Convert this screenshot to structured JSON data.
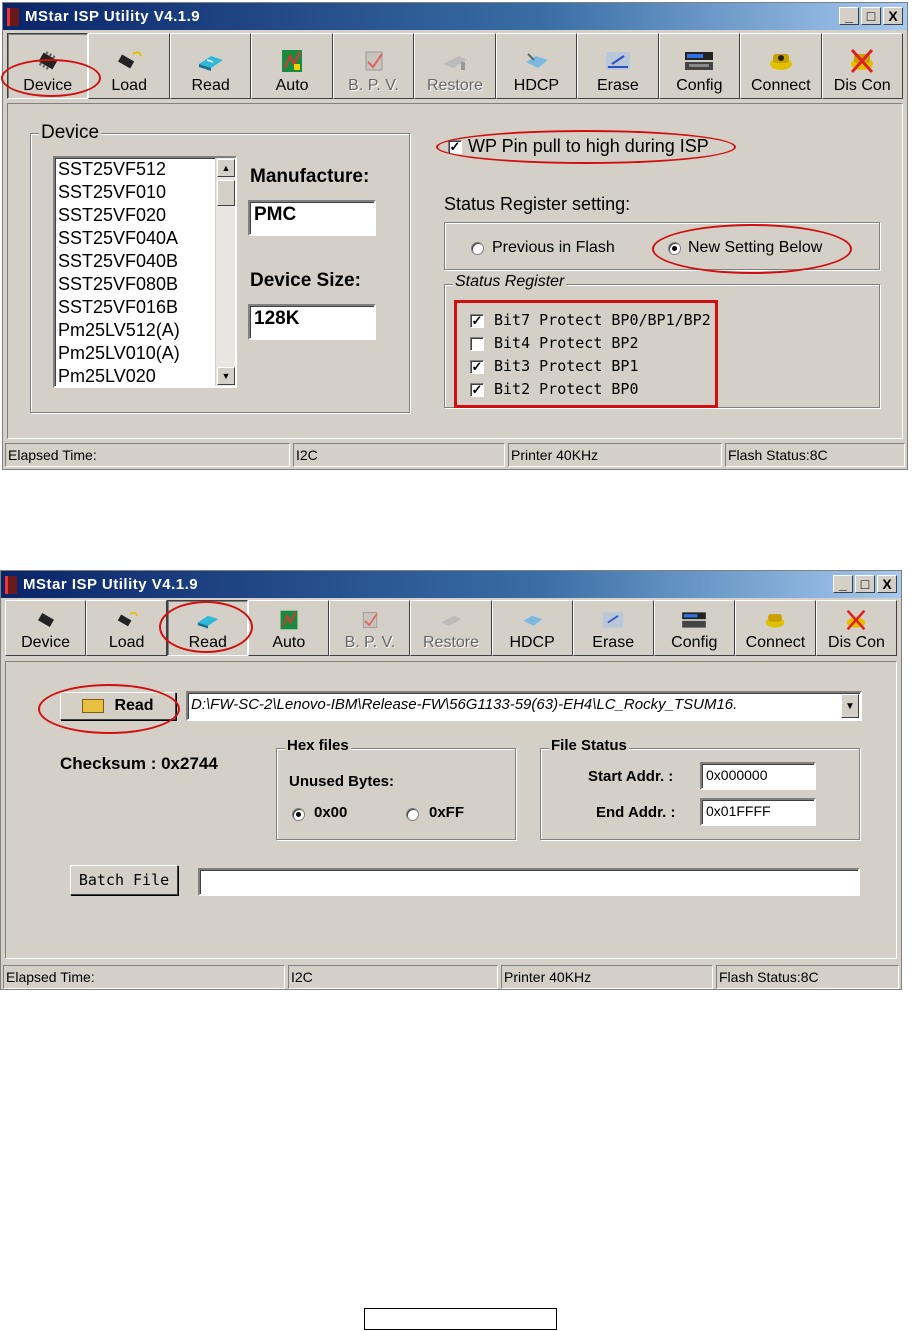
{
  "window1": {
    "title": "MStar ISP Utility V4.1.9",
    "controls": [
      "_",
      "□",
      "X"
    ],
    "toolbar": [
      {
        "label": "Device",
        "icon": "chip-icon"
      },
      {
        "label": "Load",
        "icon": "load-chip-icon"
      },
      {
        "label": "Read",
        "icon": "read-icon"
      },
      {
        "label": "Auto",
        "icon": "auto-icon"
      },
      {
        "label": "B. P. V.",
        "icon": "bpv-check-icon"
      },
      {
        "label": "Restore",
        "icon": "restore-icon"
      },
      {
        "label": "HDCP",
        "icon": "hdcp-icon"
      },
      {
        "label": "Erase",
        "icon": "erase-icon"
      },
      {
        "label": "Config",
        "icon": "config-icon"
      },
      {
        "label": "Connect",
        "icon": "connect-phone-icon"
      },
      {
        "label": "Dis Con",
        "icon": "disconnect-phone-icon"
      }
    ],
    "device_group": "Device",
    "devices": [
      "SST25VF512",
      "SST25VF010",
      "SST25VF020",
      "SST25VF040A",
      "SST25VF040B",
      "SST25VF080B",
      "SST25VF016B",
      "Pm25LV512(A)",
      "Pm25LV010(A)",
      "Pm25LV020"
    ],
    "manufacture_label": "Manufacture:",
    "manufacture_value": "PMC",
    "device_size_label": "Device Size:",
    "device_size_value": "128K",
    "wp_pin_label": "WP Pin pull to high during ISP",
    "wp_pin_checked": true,
    "status_register_setting_label": "Status Register setting:",
    "radio_previous": "Previous in Flash",
    "radio_new": "New Setting Below",
    "status_register_group": "Status Register",
    "bits": [
      {
        "label": "Bit7 Protect BP0/BP1/BP2",
        "checked": true
      },
      {
        "label": "Bit4 Protect BP2",
        "checked": false
      },
      {
        "label": "Bit3 Protect BP1",
        "checked": true
      },
      {
        "label": "Bit2 Protect BP0",
        "checked": true
      }
    ],
    "status": [
      "Elapsed Time:",
      "I2C",
      "Printer  40KHz",
      "Flash Status:8C"
    ]
  },
  "window2": {
    "title": "MStar ISP Utility V4.1.9",
    "controls": [
      "_",
      "□",
      "X"
    ],
    "read_button": "Read",
    "path": "D:\\FW-SC-2\\Lenovo-IBM\\Release-FW\\56G1133-59(63)-EH4\\LC_Rocky_TSUM16.",
    "checksum": "Checksum : 0x2744",
    "hex_files_group": "Hex files",
    "unused_bytes_label": "Unused Bytes:",
    "radio_00": "0x00",
    "radio_ff": "0xFF",
    "file_status_group": "File Status",
    "start_addr_label": "Start Addr. :",
    "start_addr_value": "0x000000",
    "end_addr_label": "End Addr. :",
    "end_addr_value": "0x01FFFF",
    "batch_file_button": "Batch File",
    "batch_file_value": "",
    "status": [
      "Elapsed Time:",
      "I2C",
      "Printer  40KHz",
      "Flash Status:8C"
    ]
  },
  "colors": {
    "window_bg": "#d4d0c8",
    "title_start": "#0a246a",
    "title_end": "#a6caf0",
    "annotation_red": "#d01010"
  }
}
